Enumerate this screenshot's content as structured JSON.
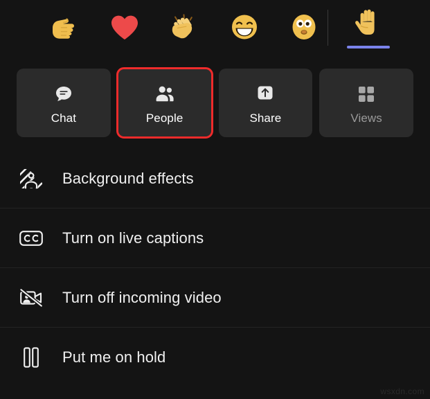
{
  "colors": {
    "background": "#141414",
    "card": "#2b2b2b",
    "highlight": "#ef2b2b",
    "accent": "#7b83eb",
    "divider": "#232323",
    "text": "#f0f0f0",
    "text_disabled": "#9a9a9a",
    "emoji_yellow": "#f5c046",
    "heart_red": "#ed4a4a"
  },
  "reaction_bar": {
    "reactions": [
      {
        "name": "thumbs-up",
        "label": "Like"
      },
      {
        "name": "heart",
        "label": "Heart"
      },
      {
        "name": "clap",
        "label": "Applause"
      },
      {
        "name": "laugh",
        "label": "Laugh"
      },
      {
        "name": "surprised",
        "label": "Surprised"
      }
    ],
    "raise_hand": {
      "name": "raise-hand",
      "label": "Raise hand",
      "active": true
    }
  },
  "quick_actions": [
    {
      "label": "Chat",
      "icon": "chat-icon",
      "highlighted": false,
      "disabled": false
    },
    {
      "label": "People",
      "icon": "people-icon",
      "highlighted": true,
      "disabled": false
    },
    {
      "label": "Share",
      "icon": "share-icon",
      "highlighted": false,
      "disabled": false
    },
    {
      "label": "Views",
      "icon": "views-icon",
      "highlighted": false,
      "disabled": true
    }
  ],
  "menu_items": [
    {
      "label": "Background effects",
      "icon": "background-effects-icon"
    },
    {
      "label": "Turn on live captions",
      "icon": "closed-captions-icon"
    },
    {
      "label": "Turn off incoming video",
      "icon": "video-off-icon"
    },
    {
      "label": "Put me on hold",
      "icon": "pause-icon"
    }
  ],
  "watermark": "wsxdn.com"
}
